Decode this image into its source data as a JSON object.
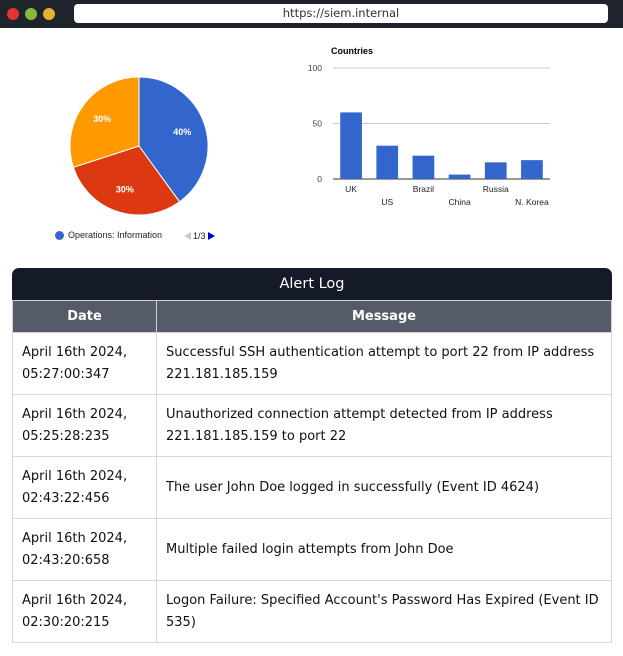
{
  "browser": {
    "url": "https://siem.internal"
  },
  "pie": {
    "legend_label": "Operations: Information",
    "pager": "1/3",
    "colors": [
      "#3366cc",
      "#dc3912",
      "#ff9900"
    ]
  },
  "chart_data": [
    {
      "type": "pie",
      "slices": [
        {
          "label": "40%",
          "value": 40,
          "color": "#3366cc"
        },
        {
          "label": "30%",
          "value": 30,
          "color": "#dc3912"
        },
        {
          "label": "30%",
          "value": 30,
          "color": "#ff9900"
        }
      ]
    },
    {
      "type": "bar",
      "title": "Countries",
      "categories": [
        "UK",
        "US",
        "Brazil",
        "China",
        "Russia",
        "N. Korea"
      ],
      "values": [
        60,
        30,
        21,
        4,
        15,
        17
      ],
      "ylim": [
        0,
        100
      ],
      "yticks": [
        0,
        50,
        100
      ],
      "grid": true,
      "color": "#3366cc"
    }
  ],
  "alert_log": {
    "title": "Alert Log",
    "columns": [
      "Date",
      "Message"
    ],
    "rows": [
      {
        "date": "April 16th 2024, 05:27:00:347",
        "message": "Successful SSH authentication attempt to port 22 from IP address 221.181.185.159"
      },
      {
        "date": "April 16th 2024, 05:25:28:235",
        "message": "Unauthorized connection attempt detected from IP address 221.181.185.159 to port 22"
      },
      {
        "date": "April 16th 2024, 02:43:22:456",
        "message": "The user John Doe logged in successfully (Event ID 4624)"
      },
      {
        "date": "April 16th 2024, 02:43:20:658",
        "message": "Multiple failed login attempts from John Doe"
      },
      {
        "date": "April 16th 2024, 02:30:20:215",
        "message": "Logon Failure: Specified Account's Password Has Expired (Event ID 535)"
      }
    ]
  }
}
